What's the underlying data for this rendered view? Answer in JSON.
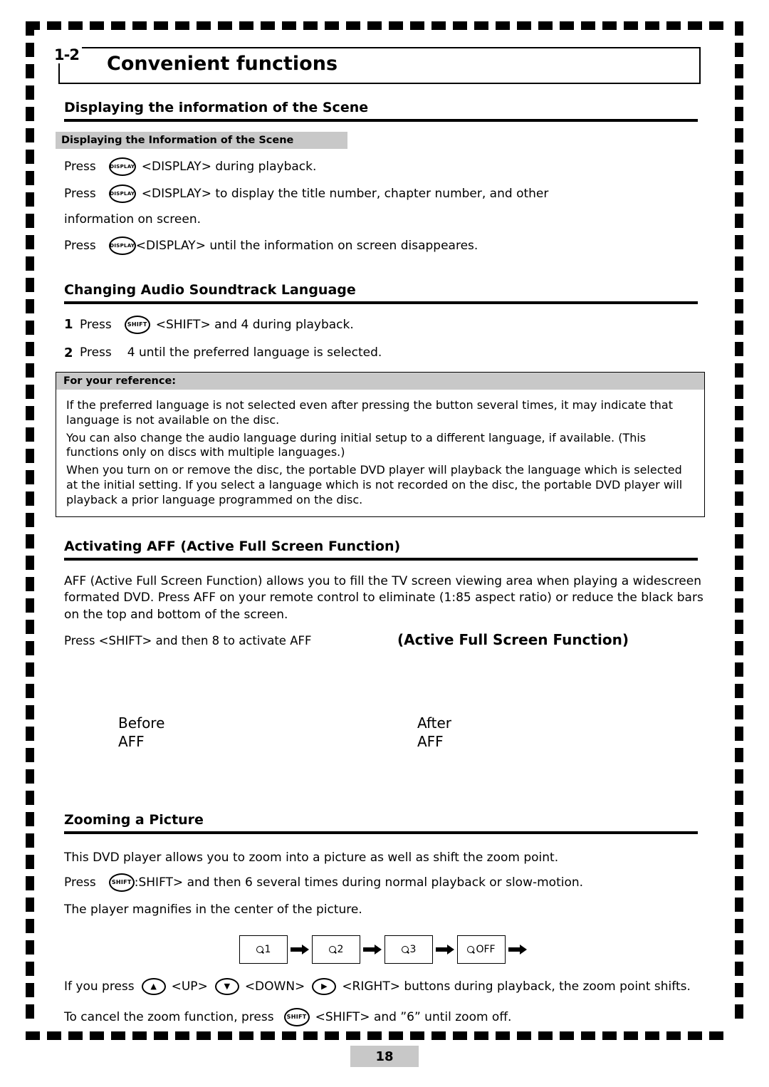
{
  "title": {
    "number": "1-2",
    "text": "Convenient functions"
  },
  "sections": {
    "scene": {
      "heading": "Displaying the information of the Scene",
      "gray_head": "Displaying the Information of the Scene",
      "lines": [
        {
          "press": "Press",
          "key": "DISPLAY",
          "text": "<DISPLAY> during playback."
        },
        {
          "press": "Press",
          "key": "DISPLAY",
          "text": "<DISPLAY> to display the title number, chapter number, and other"
        },
        {
          "press": "Press",
          "key": "DISPLAY",
          "text": "<DISPLAY> until the information on screen disappeares."
        }
      ],
      "continuation": "information on screen."
    },
    "audio": {
      "heading": "Changing Audio Soundtrack Language",
      "steps": [
        {
          "num": "1",
          "press": "Press",
          "key": "SHIFT",
          "text": "<SHIFT> and  4  during playback."
        },
        {
          "num": "2",
          "press": "Press",
          "key": "",
          "text": "4   until the preferred language is selected."
        }
      ],
      "reference": {
        "title": "For your reference:",
        "paragraphs": [
          "If the preferred language is not selected even after pressing the button several times, it may indicate that language is not available on the disc.",
          "You can also change the audio language during initial setup to a different language, if available. (This functions only on discs with multiple languages.)",
          "When you turn on or remove the disc, the portable DVD player will playback the language which is selected at the initial setting. If you select a language which is not recorded on the disc, the portable DVD player will playback a prior language programmed on the disc."
        ]
      }
    },
    "aff": {
      "heading": "Activating AFF (Active Full Screen Function)",
      "body": "AFF (Active Full Screen Function) allows you to fill the TV screen viewing area when playing a widescreen formated DVD. Press AFF on your remote control to eliminate (1:85 aspect ratio) or reduce the black bars on the top and bottom of the screen.",
      "press_line": "Press <SHIFT> and then  8  to activate AFF",
      "caption": "(Active Full Screen Function)",
      "before_label": "Before",
      "before_sub": "AFF",
      "after_label": "After",
      "after_sub": "AFF"
    },
    "zoom": {
      "heading": "Zooming a Picture",
      "intro": "This DVD player allows you to zoom into a picture as well as shift the zoom point.",
      "press_label": "Press",
      "press_key": "SHIFT",
      "press_text": ":SHIFT> and then  6   several times during normal playback or slow-motion.",
      "magnify_text": "The player magnifies in the center of the picture.",
      "chain": [
        "1",
        "2",
        "3",
        "OFF"
      ],
      "shift_line": {
        "prefix": "If you press",
        "up_label": "<UP>",
        "down_label": "<DOWN>",
        "suffix": "<RIGHT> buttons during playback, the zoom point shifts.",
        "up_icon": "▲",
        "down_icon": "▼",
        "right_icon": "▶"
      },
      "cancel_line": {
        "prefix": "To cancel the zoom function, press",
        "key": "SHIFT",
        "suffix": "<SHIFT> and ”6” until zoom off."
      }
    }
  },
  "page_number": "18"
}
